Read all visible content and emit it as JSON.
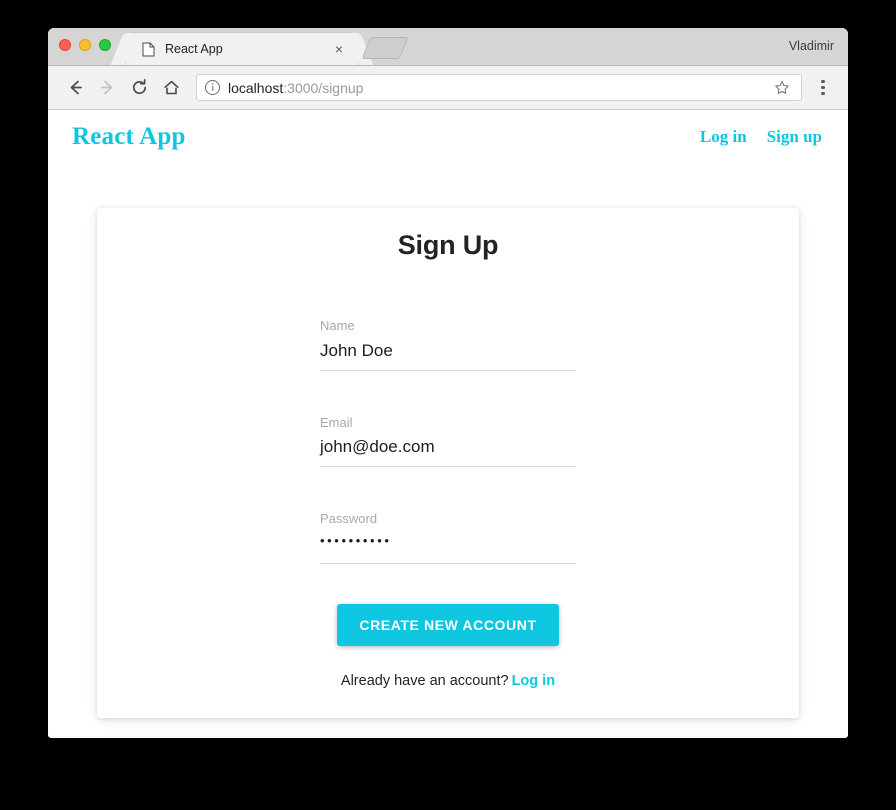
{
  "browser": {
    "window_controls": [
      "close",
      "minimize",
      "maximize"
    ],
    "tab": {
      "title": "React App",
      "favicon": "document-icon",
      "close_label": "×"
    },
    "new_tab_label": "",
    "profile_name": "Vladimir",
    "toolbar": {
      "back_label": "back-icon",
      "forward_label": "forward-icon",
      "reload_label": "reload-icon",
      "home_label": "home-icon",
      "url_host": "localhost",
      "url_path": ":3000/signup",
      "url_full": "localhost:3000/signup",
      "security_icon": "info-icon",
      "bookmark_icon": "star-icon",
      "menu_icon": "three-dot-menu-icon"
    }
  },
  "app": {
    "brand": "React App",
    "nav": [
      {
        "label": "Log in"
      },
      {
        "label": "Sign up"
      }
    ],
    "card": {
      "title": "Sign Up",
      "fields": [
        {
          "label": "Name",
          "value": "John Doe",
          "placeholder": "Name",
          "type": "text"
        },
        {
          "label": "Email",
          "value": "john@doe.com",
          "placeholder": "Email",
          "type": "email"
        },
        {
          "label": "Password",
          "value": "••••••••••",
          "placeholder": "Password",
          "type": "password"
        }
      ],
      "submit_label": "CREATE NEW ACCOUNT",
      "footer_text": "Already have an account?",
      "footer_link": "Log in"
    }
  },
  "colors": {
    "accent": "#0fc6e0",
    "text": "#232323",
    "muted": "#a9a9a9",
    "underline": "#d9d9d9"
  }
}
